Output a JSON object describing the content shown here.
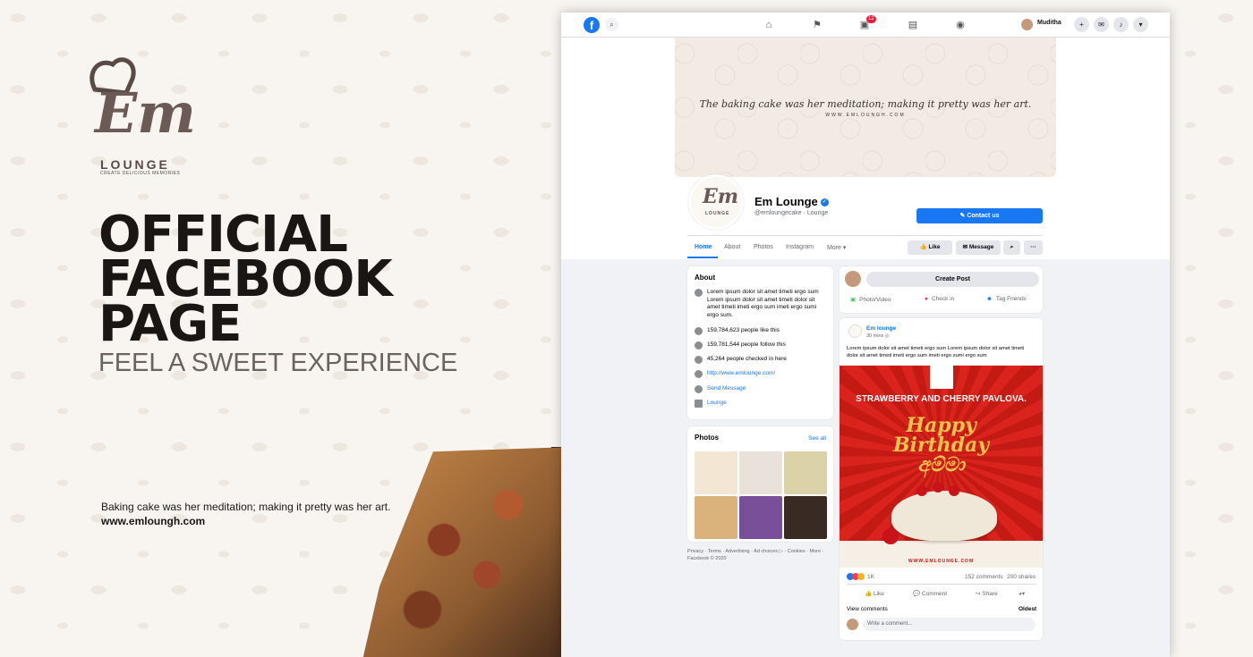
{
  "promo": {
    "logo_mark": "Em",
    "logo_word": "LOUNGE",
    "logo_tagline": "CREATE DELICIOUS MEMORIES",
    "headline": [
      "OFFICIAL",
      "FACEBOOK",
      "PAGE"
    ],
    "subheadline": "FEEL A SWEET EXPERIENCE",
    "tagline": "Baking cake was her meditation; making it pretty was her art.",
    "website": "www.emloungh.com"
  },
  "topbar": {
    "notifications_count": "12",
    "user_name": "Muditha"
  },
  "cover": {
    "quote": "The baking cake was her meditation; making it pretty was her art.",
    "url": "WWW.EMLOUNGH.COM"
  },
  "page": {
    "name": "Em Lounge",
    "handle": "@emloungecake",
    "category": "Lounge",
    "contact_button": "Contact us",
    "tabs": [
      "Home",
      "About",
      "Photos",
      "Instagram",
      "More"
    ],
    "buttons": {
      "like": "Like",
      "message": "Message"
    }
  },
  "about": {
    "title": "About",
    "description": "Lorem ipsum dolor sit amet timeti ergo sum Lorem ipsum dolor sit amet timeti dolor sit amet timeti imeti ergo sum imeti ergo sumi ergo sum.",
    "likes": "159,784,623 people like this",
    "follows": "159,781,544 people follow this",
    "checkins": "45,264 people checked in here",
    "website": "http://www.emlounge.com/",
    "send_message": "Send Message",
    "category": "Lounge"
  },
  "photos": {
    "title": "Photos",
    "see_all": "See all"
  },
  "footer": "Privacy · Terms · Advertising · Ad choices ▷ · Cookies · More · Facebook © 2020",
  "create_post": {
    "button": "Create Post",
    "photo_video": "Photo/Video",
    "check_in": "Check in",
    "tag_friends": "Tag Friends"
  },
  "post": {
    "author": "Em lounge",
    "time": "30 mins",
    "text": "Lorem ipsum dolor sit amet timeti ergo sum Lorem ipsum dolor sit amet timeti dolor sit amet timeti imeti ergo sum imeti ergo sumi ergo sum",
    "image_title": "STRAWBERRY AND CHERRY PAVLOVA.",
    "image_greeting_1": "Happy",
    "image_greeting_2": "Birthday",
    "image_greeting_3": "අම්මා",
    "image_url": "WWW.EMLOUNGE.COM",
    "reactions": "1K",
    "comments": "152 comments",
    "shares": "200 shares",
    "actions": {
      "like": "Like",
      "comment": "Comment",
      "share": "Share"
    },
    "view_comments": "View comments",
    "sort": "Oldest",
    "write_comment": "Write a comment..."
  },
  "colors": {
    "fb_blue": "#1877f2",
    "post_red": "#d9231c",
    "text_dark": "#1a1614"
  }
}
